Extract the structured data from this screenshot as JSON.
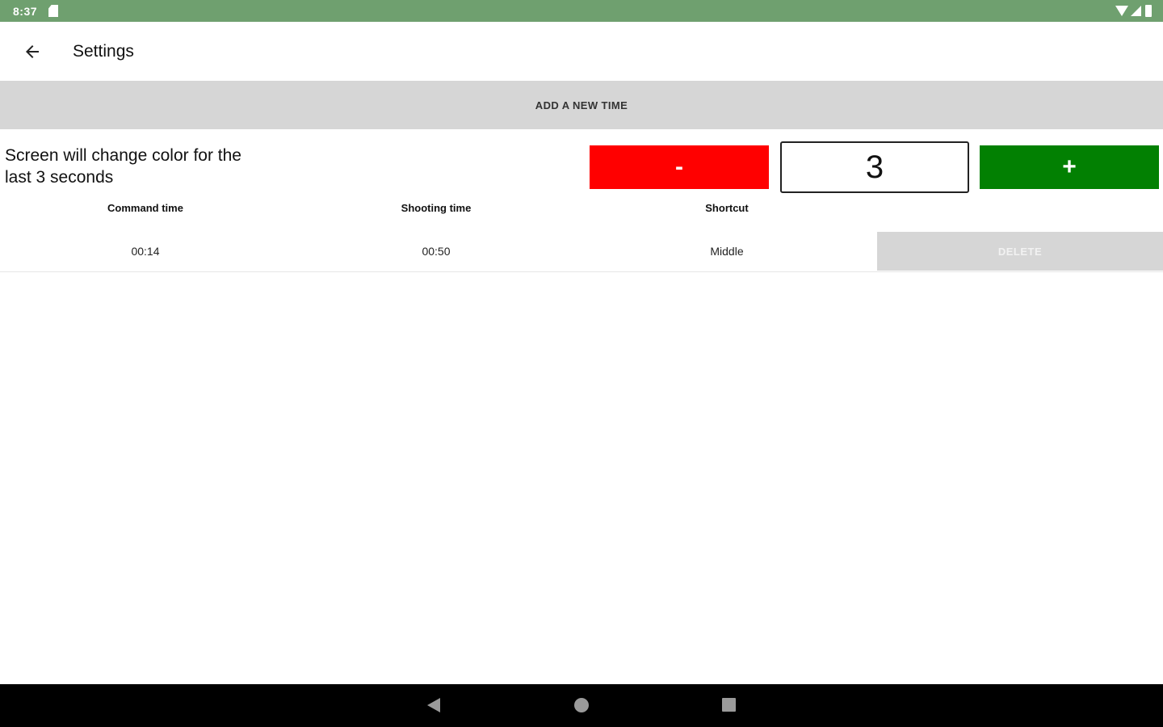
{
  "status_bar": {
    "time": "8:37",
    "icons": [
      "sd-card-icon",
      "wifi-icon",
      "signal-icon",
      "battery-icon"
    ],
    "color": "#6fa06f"
  },
  "app_bar": {
    "title": "Settings",
    "back_icon": "arrow-left-icon"
  },
  "add_button": {
    "label": "ADD A NEW TIME"
  },
  "countdown": {
    "info_text": "Screen will change color for the last 3 seconds",
    "minus_label": "-",
    "value": "3",
    "plus_label": "+",
    "minus_color": "#ff0000",
    "plus_color": "#028002"
  },
  "table": {
    "headers": [
      "Command time",
      "Shooting time",
      "Shortcut"
    ],
    "rows": [
      {
        "command_time": "00:14",
        "shooting_time": "00:50",
        "shortcut": "Middle",
        "delete_label": "DELETE"
      }
    ]
  },
  "nav_bar": {
    "icons": [
      "back-triangle-icon",
      "home-circle-icon",
      "recents-square-icon"
    ]
  }
}
